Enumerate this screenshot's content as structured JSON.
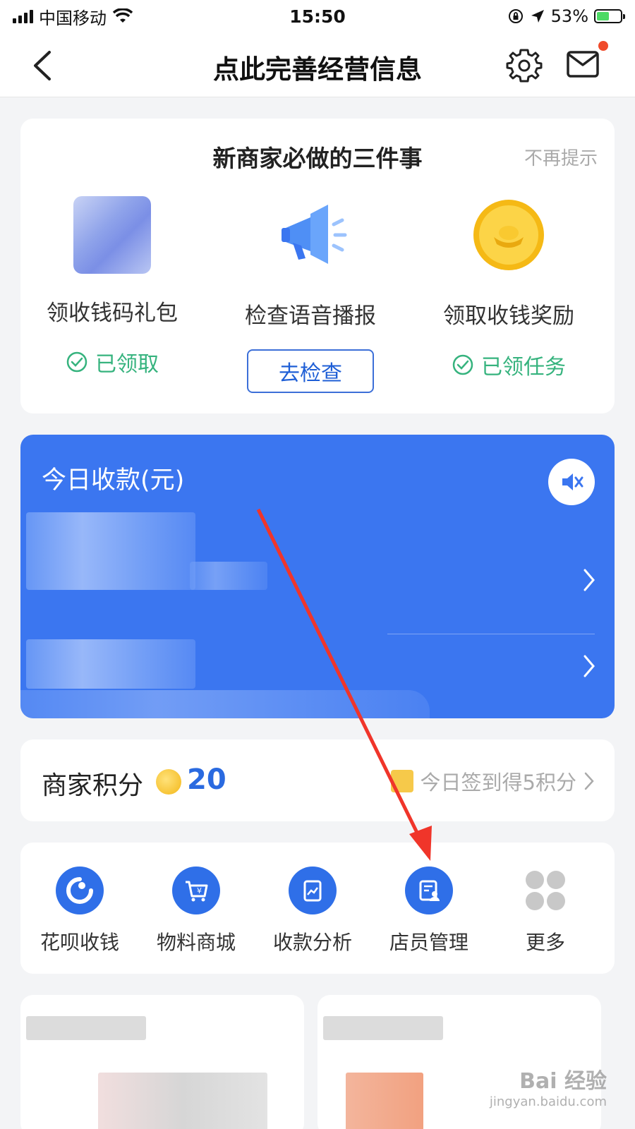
{
  "status_bar": {
    "carrier": "中国移动",
    "time": "15:50",
    "battery": "53%"
  },
  "nav": {
    "title": "点此完善经营信息"
  },
  "tasks": {
    "title": "新商家必做的三件事",
    "dismiss": "不再提示",
    "items": [
      {
        "label": "领收钱码礼包",
        "status": "已领取"
      },
      {
        "label": "检查语音播报",
        "button": "去检查"
      },
      {
        "label": "领取收钱奖励",
        "status": "已领任务"
      }
    ]
  },
  "income": {
    "title": "今日收款(元)"
  },
  "points": {
    "label": "商家积分",
    "value": "20",
    "checkin": "今日签到得5积分"
  },
  "shortcuts": [
    {
      "label": "花呗收钱",
      "icon": "huabei-icon"
    },
    {
      "label": "物料商城",
      "icon": "cart-icon"
    },
    {
      "label": "收款分析",
      "icon": "chart-icon"
    },
    {
      "label": "店员管理",
      "icon": "staff-icon"
    },
    {
      "label": "更多",
      "icon": "more-grid-icon"
    }
  ],
  "watermark": {
    "main": "Bai 经验",
    "sub": "jingyan.baidu.com"
  },
  "colors": {
    "accent": "#3b76f0",
    "success": "#36b37e",
    "annotation_arrow": "#f0352a"
  }
}
